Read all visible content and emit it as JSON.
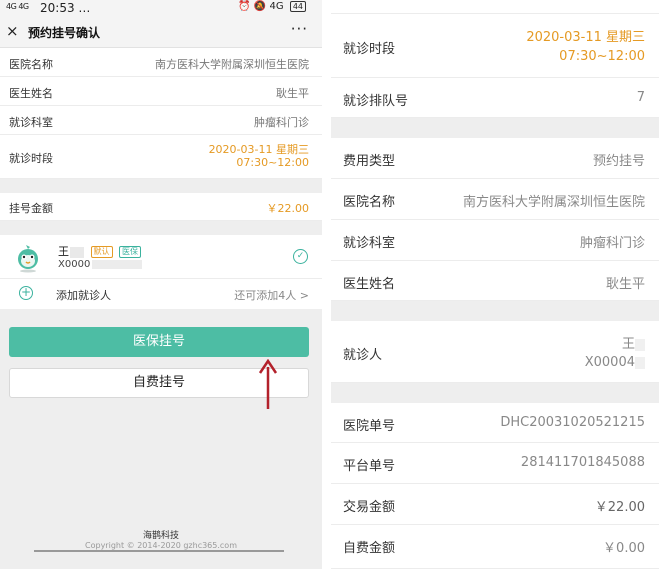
{
  "left": {
    "status": {
      "signal": "4G 4G",
      "time": "20:53 …",
      "icons": "⏰ 🔕 4G",
      "battery": "44"
    },
    "nav": {
      "close_icon": "×",
      "title": "预约挂号确认",
      "more": "···"
    },
    "info_rows": [
      {
        "label": "医院名称",
        "value": "南方医科大学附属深圳恒生医院"
      },
      {
        "label": "医生姓名",
        "value": "耿生平"
      },
      {
        "label": "就诊科室",
        "value": "肿瘤科门诊"
      },
      {
        "label": "就诊时段",
        "value_line1": "2020-03-11 星期三",
        "value_line2": "07:30~12:00"
      }
    ],
    "fee": {
      "label": "挂号金额",
      "value": "￥22.00"
    },
    "patient": {
      "name": "王",
      "tag_default": "默认",
      "tag_insurance": "医保",
      "id_prefix": "X0000",
      "add_label": "添加就诊人",
      "add_hint": "还可添加4人 >"
    },
    "buttons": {
      "insurance": "医保挂号",
      "self_pay": "自费挂号"
    },
    "footer": {
      "company": "海鹊科技",
      "copyright": "Copyright © 2014-2020 gzhc365.com"
    },
    "colors": {
      "accent": "#4dbda4",
      "orange": "#e59a24",
      "arrow": "#b3212b"
    }
  },
  "right": {
    "group1": [
      {
        "label": "就诊时段",
        "value_line1": "2020-03-11 星期三",
        "value_line2": "07:30~12:00"
      },
      {
        "label": "就诊排队号",
        "value": "7"
      }
    ],
    "group2": [
      {
        "label": "费用类型",
        "value": "预约挂号"
      },
      {
        "label": "医院名称",
        "value": "南方医科大学附属深圳恒生医院"
      },
      {
        "label": "就诊科室",
        "value": "肿瘤科门诊"
      },
      {
        "label": "医生姓名",
        "value": "耿生平"
      }
    ],
    "patient": {
      "label": "就诊人",
      "name": "王",
      "id_prefix": "X00004"
    },
    "group3": [
      {
        "label": "医院单号",
        "value": "DHC20031020521215"
      },
      {
        "label": "平台单号",
        "value": "281411701845088"
      },
      {
        "label": "交易金额",
        "value": "￥22.00"
      },
      {
        "label": "自费金额",
        "value": "￥0.00"
      }
    ]
  }
}
